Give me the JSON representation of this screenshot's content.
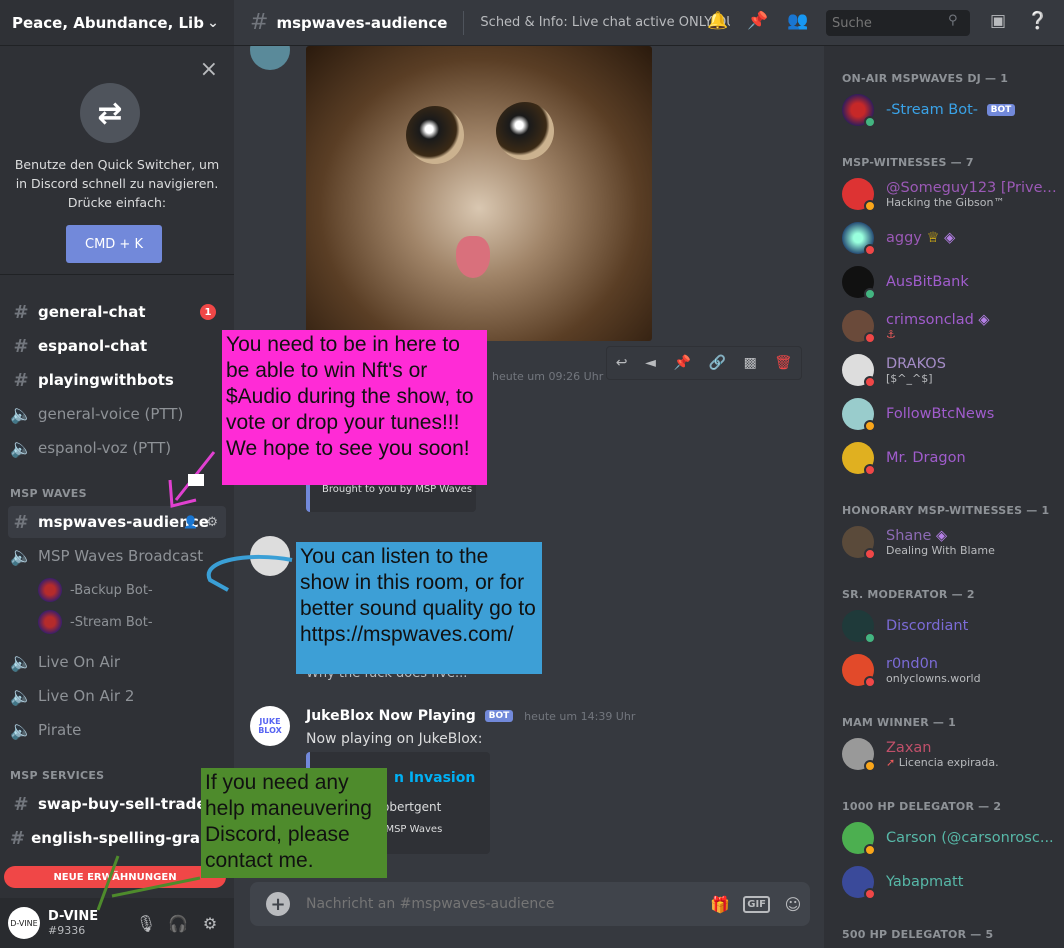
{
  "server": {
    "name": "Peace, Abundance, Lib..."
  },
  "quick_switcher": {
    "text": "Benutze den Quick Switcher, um in Discord schnell zu navigieren. Drücke einfach:",
    "shortcut": "CMD + K"
  },
  "channels": [
    {
      "name": "general-chat",
      "type": "text",
      "badge": "1"
    },
    {
      "name": "espanol-chat",
      "type": "text"
    },
    {
      "name": "playingwithbots",
      "type": "text"
    },
    {
      "name": "general-voice (PTT)",
      "type": "voice"
    },
    {
      "name": "espanol-voz (PTT)",
      "type": "voice"
    }
  ],
  "categories": {
    "msp_waves": "MSP WAVES",
    "msp_services": "MSP SERVICES"
  },
  "msp_channels": [
    {
      "name": "mspwaves-audience",
      "type": "text",
      "selected": true
    },
    {
      "name": "MSP Waves Broadcast",
      "type": "voice"
    },
    {
      "name": "Live On Air",
      "type": "voice"
    },
    {
      "name": "Live On Air 2",
      "type": "voice"
    },
    {
      "name": "Pirate",
      "type": "voice"
    }
  ],
  "voice_users": [
    "-Backup Bot-",
    "-Stream Bot-"
  ],
  "service_channels": [
    {
      "name": "swap-buy-sell-trade",
      "type": "text"
    },
    {
      "name": "english-spelling-gramma",
      "type": "text"
    }
  ],
  "new_messages_label": "NEUE ERWÄHNUNGEN",
  "user": {
    "name": "D-VINE",
    "tag": "#9336",
    "avatar_text": "D-VINE"
  },
  "header": {
    "channel": "mspwaves-audience",
    "topic": "Sched & Info: Live chat active ONLY DU...",
    "search_placeholder": "Suche"
  },
  "messages": {
    "first_time": "heute um 09:26 Uhr",
    "first_embed_footer": "Brought to you by MSP Waves",
    "partial_text": "Why the fuck does five...",
    "jukebox": {
      "author": "JukeBlox Now Playing",
      "bot": "BOT",
      "time": "heute um 14:39 Uhr",
      "text": "Now playing on JukeBlox:",
      "embed_title": "n Invasion",
      "embed_sub": "obertgent",
      "embed_footer": "by MSP Waves",
      "avatar_text": "JUKE BLOX"
    }
  },
  "annotations": {
    "pink": "You need to be in here to be able to win Nft's or $Audio during the show, to vote or drop your tunes!!! We hope to see you soon!",
    "blue": "You can listen to the show in this room, or for better sound quality go to https://mspwaves.com/",
    "green": "If you need any help maneuvering Discord, please contact me."
  },
  "composer": {
    "placeholder": "Nachricht an #mspwaves-audience",
    "gif": "GIF"
  },
  "members": {
    "groups": [
      {
        "title": "ON-AIR MSPWAVES DJ — 1"
      },
      {
        "title": "MSP-WITNESSES — 7"
      },
      {
        "title": "HONORARY MSP-WITNESSES — 1"
      },
      {
        "title": "SR. MODERATOR — 2"
      },
      {
        "title": "MAM WINNER — 1"
      },
      {
        "title": "1000 HP DELEGATOR — 2"
      },
      {
        "title": "500 HP DELEGATOR — 5"
      }
    ],
    "list": [
      {
        "name": "-Stream Bot-",
        "bot": "BOT",
        "activity": ""
      },
      {
        "name": "@Someguy123 [Privex...",
        "activity": "Hacking the Gibson™"
      },
      {
        "name": "aggy",
        "activity": ""
      },
      {
        "name": "AusBitBank",
        "activity": ""
      },
      {
        "name": "crimsonclad",
        "activity": ""
      },
      {
        "name": "DRAKOS",
        "activity": "[$^_^$]"
      },
      {
        "name": "FollowBtcNews",
        "activity": ""
      },
      {
        "name": "Mr. Dragon",
        "activity": ""
      },
      {
        "name": "Shane",
        "activity": "Dealing With Blame"
      },
      {
        "name": "Discordiant",
        "activity": ""
      },
      {
        "name": "r0nd0n",
        "activity": "onlyclowns.world"
      },
      {
        "name": "Zaxan",
        "activity": "Licencia expirada."
      },
      {
        "name": "Carson (@carsonrosc...",
        "activity": ""
      },
      {
        "name": "Yabapmatt",
        "activity": ""
      }
    ]
  },
  "colors": {
    "accent": "#7289da",
    "danger": "#f04747",
    "online": "#43b581"
  }
}
